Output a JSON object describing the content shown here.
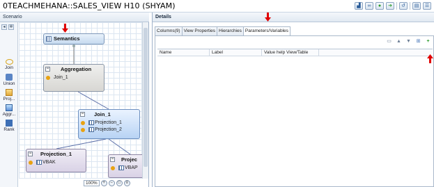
{
  "window": {
    "title": "0TEACHMEHANA::SALES_VIEW H10 (SHYAM)"
  },
  "toolbar_icons": [
    "chart-icon",
    "binoculars-icon",
    "run-icon",
    "forward-icon",
    "history-icon",
    "document-icon",
    "list-icon"
  ],
  "scenario": {
    "header": "Scenario",
    "palette": [
      {
        "label": "Join",
        "icon": "join-icon"
      },
      {
        "label": "Union",
        "icon": "union-icon"
      },
      {
        "label": "Proj...",
        "icon": "projection-icon"
      },
      {
        "label": "Aggr...",
        "icon": "aggregation-icon"
      },
      {
        "label": "Rank",
        "icon": "rank-icon"
      }
    ],
    "nodes": {
      "semantics": {
        "title": "Semantics"
      },
      "aggregation": {
        "title": "Aggregation",
        "input": "Join_1"
      },
      "join": {
        "title": "Join_1",
        "inputs": [
          "Projection_1",
          "Projection_2"
        ]
      },
      "projection1": {
        "title": "Projection_1",
        "table": "VBAK"
      },
      "projection2": {
        "title": "Projec",
        "table": "VBAP"
      }
    },
    "zoom": {
      "level": "100%"
    }
  },
  "details": {
    "header": "Details",
    "tabs": [
      "Columns(9)",
      "View Properties",
      "Hierarchies",
      "Parameters/Variables"
    ],
    "active_tab": "Parameters/Variables",
    "table": {
      "columns": [
        "Name",
        "Label",
        "Value help View/Table",
        ""
      ]
    }
  },
  "colors": {
    "annotation_arrow": "#e00000",
    "join_node": "#b8d3f4",
    "projection_node": "#d9d2e6"
  }
}
